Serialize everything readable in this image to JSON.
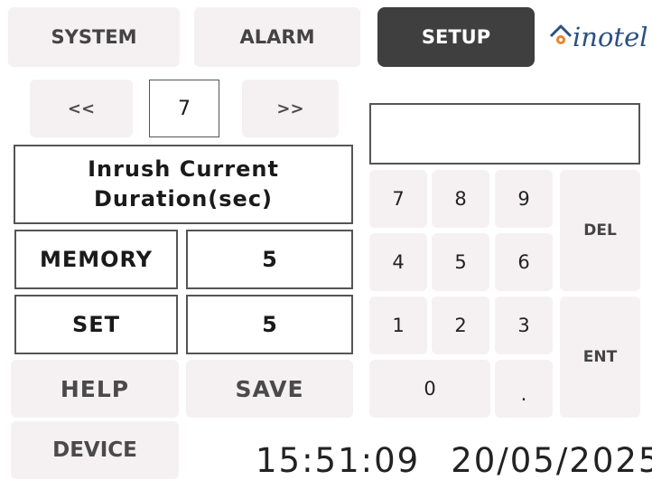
{
  "tabs": [
    {
      "label": "SYSTEM"
    },
    {
      "label": "ALARM"
    },
    {
      "label": "SETUP",
      "active": true
    }
  ],
  "logo": {
    "text": "inotel"
  },
  "pager": {
    "prev_label": "<<",
    "page": "7",
    "next_label": ">>"
  },
  "parameter": {
    "title_line1": "Inrush Current",
    "title_line2": "Duration(sec)"
  },
  "memory": {
    "label": "MEMORY",
    "value": "5"
  },
  "set": {
    "label": "SET",
    "value": "5"
  },
  "actions": {
    "help_label": "HELP",
    "save_label": "SAVE",
    "device_label": "DEVICE"
  },
  "keypad": {
    "display": "",
    "keys": [
      "7",
      "8",
      "9",
      "4",
      "5",
      "6",
      "1",
      "2",
      "3",
      "0",
      "."
    ],
    "del_label": "DEL",
    "ent_label": "ENT"
  },
  "status": {
    "time": "15:51:09",
    "date": "20/05/2025"
  },
  "colors": {
    "active_tab": "#3f3f3f",
    "button_bg": "#f5f1f3",
    "logo_blue": "#2c4f82",
    "logo_orange": "#e8832a"
  }
}
